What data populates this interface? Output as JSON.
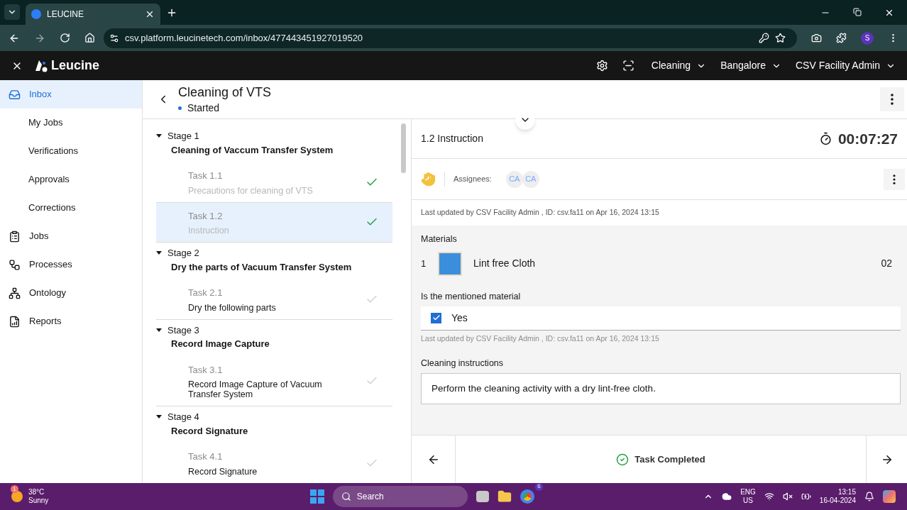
{
  "browser": {
    "tab_title": "LEUCINE",
    "url": "csv.platform.leucinetech.com/inbox/477443451927019520",
    "profile": "S"
  },
  "header": {
    "logo": "Leucine",
    "menus": [
      "Cleaning",
      "Bangalore",
      "CSV Facility Admin"
    ]
  },
  "sidebar": {
    "items": [
      {
        "label": "Inbox",
        "selected": true,
        "children": [
          {
            "label": "My Jobs",
            "selected": false
          },
          {
            "label": "Verifications",
            "selected": false
          },
          {
            "label": "Approvals",
            "selected": false
          },
          {
            "label": "Corrections",
            "selected": false
          }
        ]
      },
      {
        "label": "Jobs",
        "selected": false
      },
      {
        "label": "Processes",
        "selected": false
      },
      {
        "label": "Ontology",
        "selected": false
      },
      {
        "label": "Reports",
        "selected": false
      }
    ]
  },
  "job": {
    "title": "Cleaning of VTS",
    "status": "Started"
  },
  "stages": [
    {
      "label": "Stage 1",
      "name": "Cleaning of Vaccum Transfer System",
      "expanded": true,
      "tasks": [
        {
          "label": "Task 1.1",
          "name": "Precautions for cleaning of VTS",
          "completed": true,
          "selected": false
        },
        {
          "label": "Task 1.2",
          "name": "Instruction",
          "completed": true,
          "selected": true
        }
      ]
    },
    {
      "label": "Stage 2",
      "name": "Dry the parts of Vacuum Transfer System",
      "expanded": true,
      "tasks": [
        {
          "label": "Task 2.1",
          "name": "Dry the following parts",
          "completed": false,
          "selected": false
        }
      ]
    },
    {
      "label": "Stage 3",
      "name": "Record Image Capture",
      "expanded": true,
      "tasks": [
        {
          "label": "Task 3.1",
          "name": "Record Image Capture of Vacuum Transfer System",
          "completed": false,
          "selected": false
        }
      ]
    },
    {
      "label": "Stage 4",
      "name": "Record Signature",
      "expanded": true,
      "tasks": [
        {
          "label": "Task 4.1",
          "name": "Record Signature",
          "completed": false,
          "selected": false
        }
      ]
    }
  ],
  "task": {
    "title": "1.2 Instruction",
    "timer": "00:07:27",
    "assignees_label": "Assignees:",
    "assignees": [
      "CA",
      "CA"
    ],
    "last_updated": "Last updated by CSV Facility Admin , ID: csv.fa11 on Apr 16, 2024 13:15",
    "materials_label": "Materials",
    "materials": [
      {
        "index": "1",
        "name": "Lint free Cloth",
        "quantity": "02"
      }
    ],
    "question": "Is the mentioned material",
    "options": [
      {
        "label": "Yes",
        "checked": true
      }
    ],
    "answer_updated": "Last updated by CSV Facility Admin , ID: csv.fa11 on Apr 16, 2024 13:15",
    "instructions_label": "Cleaning instructions",
    "instructions": "Perform the cleaning activity with a dry lint-free cloth.",
    "footer_status": "Task Completed"
  },
  "taskbar": {
    "weather_badge": "1",
    "temperature": "38°C",
    "condition": "Sunny",
    "search": "Search",
    "chrome_badge": "S",
    "language": "ENG",
    "region": "US",
    "time": "13:15",
    "date": "16-04-2024"
  }
}
